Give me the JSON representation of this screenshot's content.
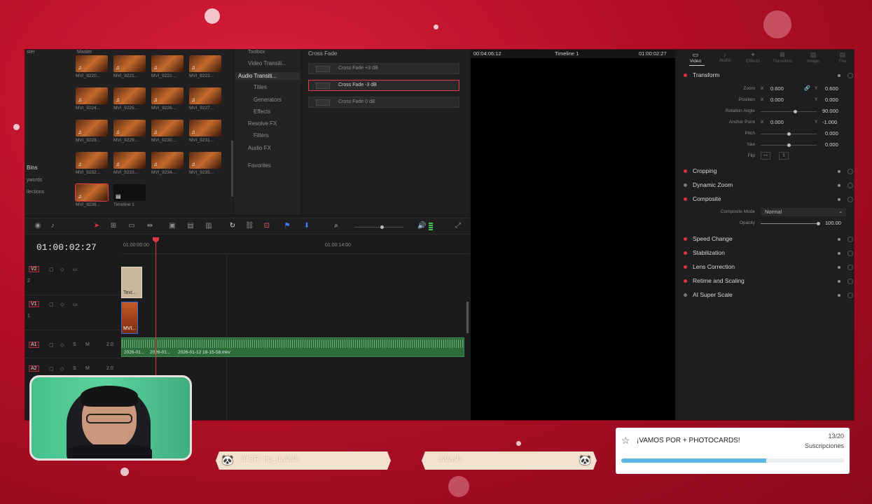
{
  "media_pool": {
    "header_left": "ster",
    "header_master": "Master",
    "sidebar": [
      "Bins",
      "ywords",
      "llections"
    ],
    "clips": [
      {
        "name": "MVI_9220..."
      },
      {
        "name": "MVI_9221..."
      },
      {
        "name": "MVI_9222..."
      },
      {
        "name": "MVI_9223..."
      },
      {
        "name": "MVI_9224..."
      },
      {
        "name": "MVI_9225..."
      },
      {
        "name": "MVI_9226..."
      },
      {
        "name": "MVI_9227..."
      },
      {
        "name": "MVI_9228..."
      },
      {
        "name": "MVI_9229..."
      },
      {
        "name": "MVI_9230..."
      },
      {
        "name": "MVI_9231..."
      },
      {
        "name": "MVI_9232..."
      },
      {
        "name": "MVI_9233..."
      },
      {
        "name": "MVI_9234..."
      },
      {
        "name": "MVI_9235..."
      },
      {
        "name": "MVI_9236..."
      },
      {
        "name": "Timeline 1"
      }
    ]
  },
  "effects": {
    "toolbox": "Toolbox",
    "items": [
      "Video Transiti...",
      "Audio Transiti...",
      "Titles",
      "Generators",
      "Effects",
      "Resolve FX",
      "Filters",
      "Audio FX",
      "Favorites"
    ],
    "active_index": 1,
    "category_title": "Cross Fade",
    "list": [
      "Cross Fade +3 dB",
      "Cross Fade -3 dB",
      "Cross Fade 0 dB"
    ],
    "selected_index": 1
  },
  "timeline": {
    "timecode": "01:00:02:27",
    "ruler_start": "01:00:00:00",
    "ruler_mid": "01:00:14:00",
    "tracks": [
      {
        "id": "V2",
        "num": "2"
      },
      {
        "id": "V1",
        "num": "1"
      },
      {
        "id": "A1",
        "level": "2.0"
      },
      {
        "id": "A2",
        "level": "2.0"
      }
    ],
    "v2_clip": "Text...",
    "v1_clip": "MVI...",
    "audio_clips": [
      "2026-01...",
      "2026-01...",
      "2026-01-12 18-15-58.mkv"
    ]
  },
  "viewer": {
    "timecode_left": "00:04:06:12",
    "title": "Timeline 1",
    "timecode_right": "01:00:02:27"
  },
  "inspector": {
    "tabs": [
      "Video",
      "Audio",
      "Effects",
      "Transition",
      "Image",
      "File"
    ],
    "active_tab": 0,
    "transform": {
      "title": "Transform",
      "zoom_label": "Zoom",
      "zoom_x": "0.600",
      "zoom_y": "0.600",
      "position_label": "Position",
      "position_x": "0.000",
      "position_y": "0.000",
      "rotation_label": "Rotation Angle",
      "rotation": "90.000",
      "anchor_label": "Anchor Point",
      "anchor_x": "0.000",
      "anchor_y": "-1.000",
      "pitch_label": "Pitch",
      "pitch": "0.000",
      "yaw_label": "Yaw",
      "yaw": "0.000",
      "flip_label": "Flip",
      "x": "X",
      "y": "Y"
    },
    "sections": [
      "Cropping",
      "Dynamic Zoom",
      "Composite",
      "Speed Change",
      "Stabilization",
      "Lens Correction",
      "Retime and Scaling",
      "AI Super Scale"
    ],
    "composite": {
      "mode_label": "Composite Mode",
      "mode_value": "Normal",
      "opacity_label": "Opacity",
      "opacity_value": "100.00"
    }
  },
  "overlay": {
    "banner_left": "IDER: rip_dalash",
    "banner_right": "dalash",
    "goal_title": "¡VAMOS POR + PHOTOCARDS!",
    "goal_count": "13/20",
    "goal_label": "Suscripciones",
    "goal_progress": 0.65,
    "accent": "#e0323f",
    "bar_color": "#5ab8e4"
  }
}
